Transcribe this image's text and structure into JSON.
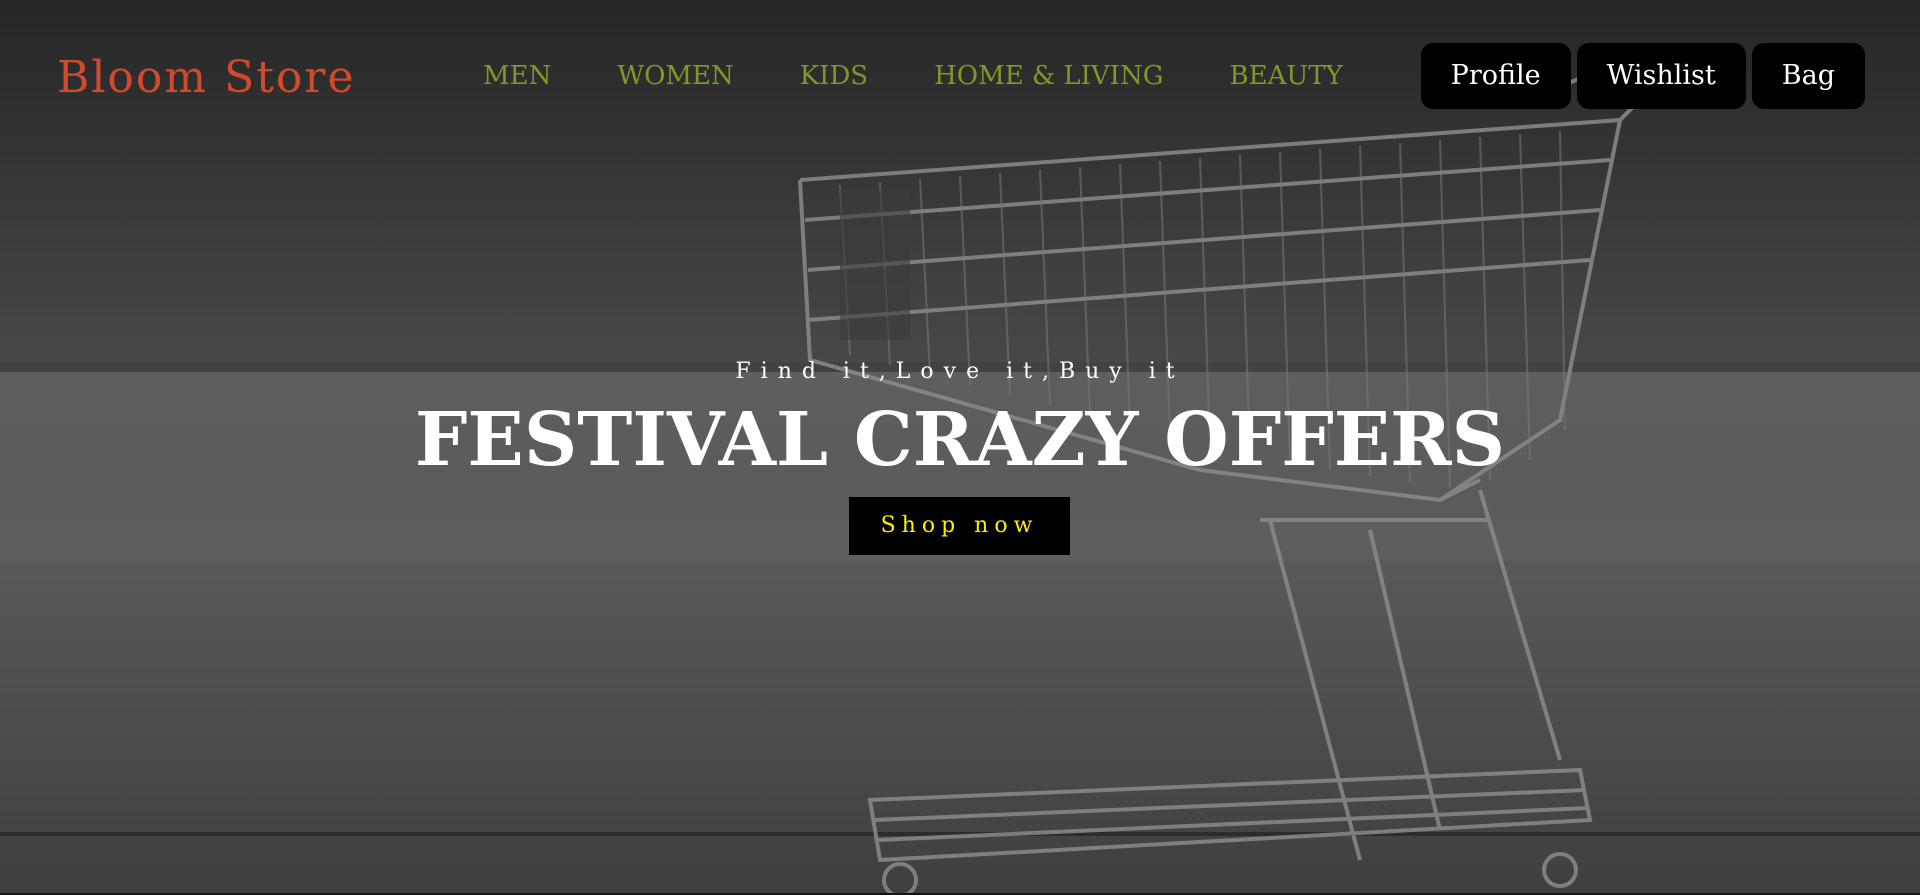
{
  "header": {
    "logo": "Bloom Store",
    "nav": [
      {
        "label": "MEN"
      },
      {
        "label": "WOMEN"
      },
      {
        "label": "KIDS"
      },
      {
        "label": "HOME & LIVING"
      },
      {
        "label": "BEAUTY"
      }
    ],
    "actions": {
      "profile": "Profile",
      "wishlist": "Wishlist",
      "bag": "Bag"
    }
  },
  "hero": {
    "tagline": "Find it,Love it,Buy it",
    "headline": "FESTIVAL CRAZY OFFERS",
    "cta": "Shop now",
    "image_subject": "shopping-cart-photo"
  },
  "colors": {
    "logo": "#d14a2c",
    "nav_link": "#7c9a2a",
    "cta_text": "#ffee00",
    "button_bg": "#000000",
    "text_light": "#ffffff"
  }
}
